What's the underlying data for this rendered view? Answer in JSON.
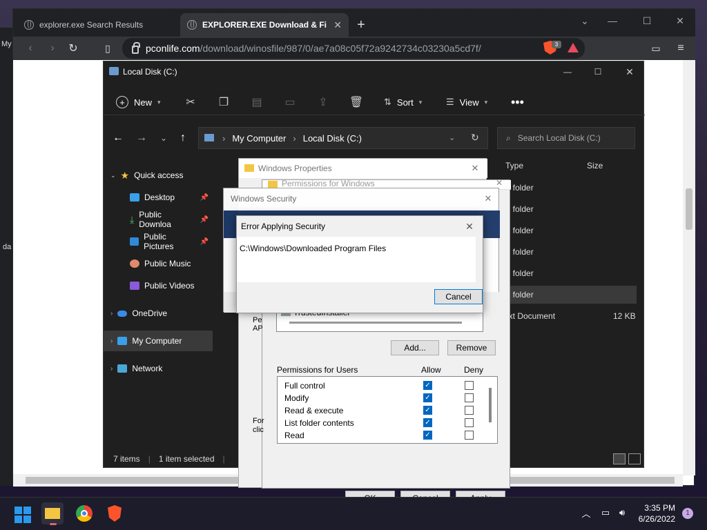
{
  "browser": {
    "tabs": [
      {
        "label": "explorer.exe Search Results"
      },
      {
        "label": "EXPLORER.EXE Download & Fix F"
      }
    ],
    "url_host": "pconlife.com",
    "url_path": "/download/winosfile/987/0/ae7a08c05f72a9242734c03230a5cd7f/",
    "brave_badge": "3",
    "left_strip_text": "My",
    "left_strip_text2": "da",
    "colors": {
      "brave": "#fb542b",
      "warning": "#e84a5f"
    }
  },
  "explorer": {
    "title": "Local Disk (C:)",
    "commands": {
      "new": "New",
      "sort": "Sort",
      "view": "View"
    },
    "address": {
      "root": "My Computer",
      "current": "Local Disk (C:)"
    },
    "search_placeholder": "Search Local Disk (C:)",
    "nav": {
      "quick_access": "Quick access",
      "items": [
        {
          "label": "Desktop"
        },
        {
          "label": "Public Downloa"
        },
        {
          "label": "Public Pictures"
        },
        {
          "label": "Public Music"
        },
        {
          "label": "Public Videos"
        }
      ],
      "onedrive": "OneDrive",
      "mycomputer": "My Computer",
      "network": "Network"
    },
    "columns": {
      "type": "Type",
      "size": "Size"
    },
    "files": [
      {
        "type": "le folder",
        "size": ""
      },
      {
        "type": "le folder",
        "size": ""
      },
      {
        "type": "le folder",
        "size": ""
      },
      {
        "type": "le folder",
        "size": ""
      },
      {
        "type": "le folder",
        "size": ""
      },
      {
        "type": "le folder",
        "size": ""
      },
      {
        "type": "ext Document",
        "size": "12 KB"
      }
    ],
    "status": {
      "items": "7 items",
      "selected": "1 item selected"
    }
  },
  "props": {
    "title": "Windows Properties",
    "behind_title": "Permissions for Windows",
    "group_user": "TrustedInstaller",
    "add": "Add...",
    "remove": "Remove",
    "perms_label": "Permissions for Users",
    "allow": "Allow",
    "deny": "Deny",
    "rows": [
      {
        "label": "Full control",
        "allow": true,
        "deny": false
      },
      {
        "label": "Modify",
        "allow": true,
        "deny": false
      },
      {
        "label": "Read & execute",
        "allow": true,
        "deny": false
      },
      {
        "label": "List folder contents",
        "allow": true,
        "deny": false
      },
      {
        "label": "Read",
        "allow": true,
        "deny": false
      }
    ],
    "left_frag1": "Pe",
    "left_frag2": "AP",
    "left_frag3": "For",
    "left_frag4": "clic",
    "ok": "OK",
    "cancel": "Cancel",
    "apply": "Apply"
  },
  "winsec": {
    "title": "Windows Security"
  },
  "error": {
    "title": "Error Applying Security",
    "path": "C:\\Windows\\Downloaded Program Files",
    "cancel": "Cancel"
  },
  "taskbar": {
    "time": "3:35 PM",
    "date": "6/26/2022",
    "notifications": "1"
  }
}
